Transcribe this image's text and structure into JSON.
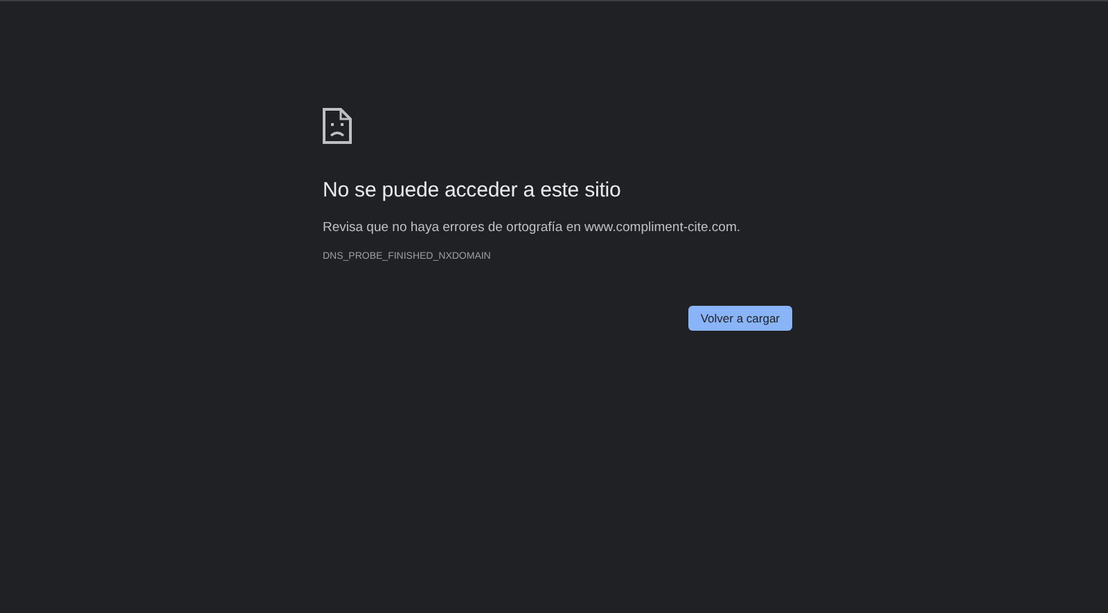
{
  "error_page": {
    "title": "No se puede acceder a este sitio",
    "message": "Revisa que no haya errores de ortografía en www.compliment-cite.com.",
    "error_code": "DNS_PROBE_FINISHED_NXDOMAIN",
    "buttons": [
      "Volver a cargar"
    ]
  }
}
